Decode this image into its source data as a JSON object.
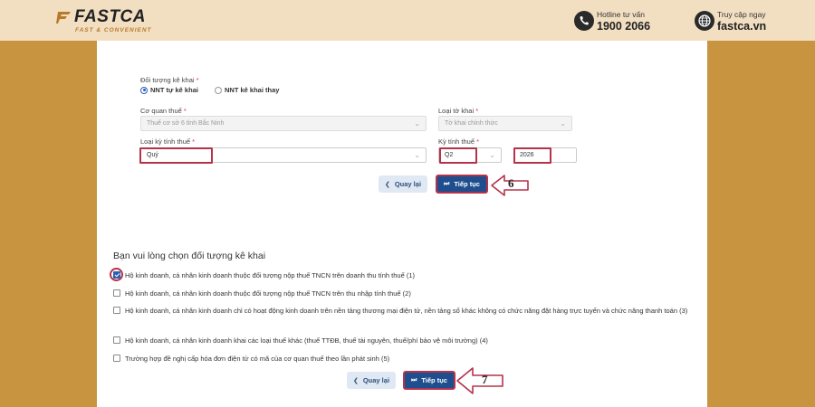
{
  "header": {
    "logo_text": "FASTCA",
    "logo_tagline": "FAST & CONVENIENT",
    "hotline_label": "Hotline tư vấn",
    "hotline_number": "1900 2066",
    "access_label": "Truy cập ngay",
    "access_site": "fastca.vn"
  },
  "form": {
    "declarant_label": "Đối tượng kê khai",
    "required_mark": "*",
    "radio_self": "NNT tự kê khai",
    "radio_proxy": "NNT kê khai thay",
    "tax_office_label": "Cơ quan thuế",
    "tax_office_value": "Thuế cơ sở 6 tỉnh Bắc Ninh",
    "form_type_label": "Loại tờ khai",
    "form_type_value": "Tờ khai chính thức",
    "period_type_label": "Loại kỳ tính thuế",
    "period_type_value": "Quý",
    "period_label": "Kỳ tính thuế",
    "period_value": "Q2",
    "year_value": "2026",
    "back_label": "Quay lại",
    "next_label": "Tiếp tục",
    "step_number": "6"
  },
  "subjects": {
    "title": "Bạn vui lòng chọn đối tượng kê khai",
    "options": [
      {
        "text": "Hộ kinh doanh, cá nhân kinh doanh thuộc đối tượng nộp thuế TNCN trên doanh thu tính thuế (1)",
        "checked": true
      },
      {
        "text": "Hộ kinh doanh, cá nhân kinh doanh thuộc đối tượng nộp thuế TNCN trên thu nhập tính thuế (2)",
        "checked": false
      },
      {
        "text": "Hộ kinh doanh, cá nhân kinh doanh chỉ có hoạt động kinh doanh trên nền tảng thương mại điện tử, nền tảng số khác không có chức năng đặt hàng trực tuyến và chức năng thanh toán (3)",
        "checked": false
      },
      {
        "text": "Hộ kinh doanh, cá nhân kinh doanh khai các loại thuế khác (thuế TTĐB, thuế tài nguyên, thuế/phí bảo vệ môi trường) (4)",
        "checked": false
      },
      {
        "text": "Trường hợp đề nghị cấp hóa đơn điện tử có mã của cơ quan thuế theo lần phát sinh (5)",
        "checked": false
      }
    ],
    "back_label": "Quay lại",
    "next_label": "Tiếp tục",
    "step_number": "7"
  },
  "colors": {
    "background": "#c99440",
    "header": "#f2dfc2",
    "primary": "#1f4e8e",
    "highlight": "#b5334a"
  }
}
